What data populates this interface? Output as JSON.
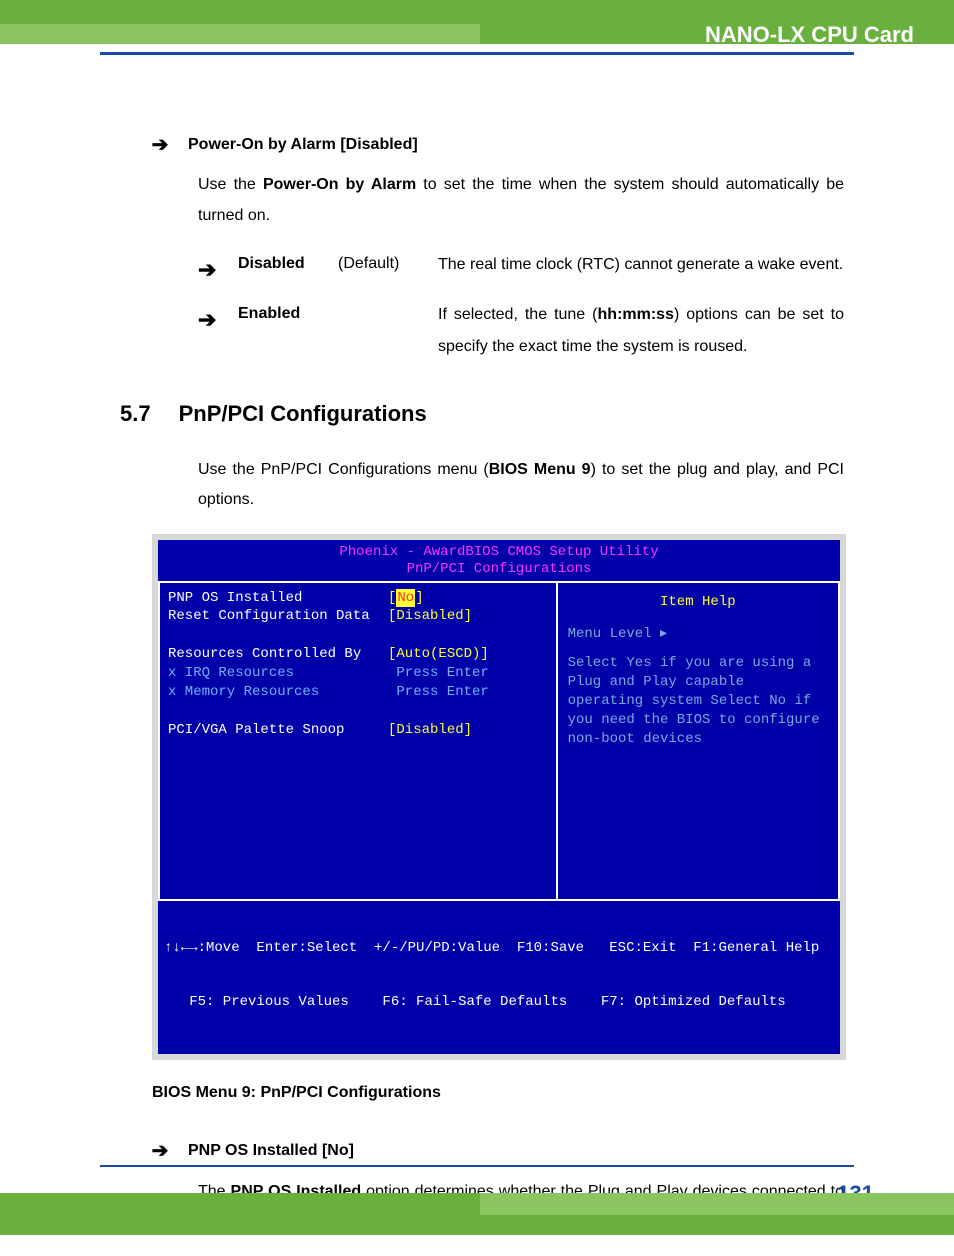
{
  "header": {
    "title": "NANO-LX CPU Card"
  },
  "footer": {
    "page": "131"
  },
  "item1": {
    "heading": "Power-On by Alarm [Disabled]",
    "body_pre": "Use the ",
    "body_bold": "Power-On by Alarm",
    "body_post": " to set the time when the system should automatically be turned on.",
    "options": [
      {
        "name": "Disabled",
        "def": "(Default)",
        "desc": "The real time clock (RTC) cannot generate a wake event."
      },
      {
        "name": "Enabled",
        "def": "",
        "desc_pre": "If selected, the tune (",
        "desc_bold": "hh:mm:ss",
        "desc_post": ") options can be set to specify the exact time the system is roused."
      }
    ]
  },
  "section": {
    "num": "5.7",
    "title": "PnP/PCI Configurations",
    "body_pre": "Use the PnP/PCI Configurations menu (",
    "body_bold": "BIOS Menu 9",
    "body_post": ") to set the plug and play, and PCI options."
  },
  "bios": {
    "title1": "Phoenix - AwardBIOS CMOS Setup Utility",
    "title2": "PnP/PCI Configurations",
    "lines": [
      {
        "label": "PNP OS Installed",
        "bracket_l": "[",
        "val": "No",
        "bracket_r": "]",
        "hilite": true
      },
      {
        "label": "Reset Configuration Data",
        "bracket_l": "[",
        "val": "Disabled",
        "bracket_r": "]"
      },
      {
        "label": ""
      },
      {
        "label": "Resources Controlled By",
        "bracket_l": "[",
        "val": "Auto(ESCD)",
        "bracket_r": "]"
      },
      {
        "label": "x IRQ Resources",
        "plain": " Press Enter",
        "dim": true
      },
      {
        "label": "x Memory Resources",
        "plain": " Press Enter",
        "dim": true
      },
      {
        "label": ""
      },
      {
        "label": "PCI/VGA Palette Snoop",
        "bracket_l": "[",
        "val": "Disabled",
        "bracket_r": "]"
      }
    ],
    "right_header": "Item Help",
    "right_body1": "Menu Level   ▸",
    "right_body2": "Select Yes if you are using a Plug and Play capable operating system Select No if you need the BIOS to configure non-boot devices",
    "foot1": "↑↓←→:Move  Enter:Select  +/-/PU/PD:Value  F10:Save   ESC:Exit  F1:General Help",
    "foot2": "   F5: Previous Values    F6: Fail-Safe Defaults    F7: Optimized Defaults"
  },
  "caption": "BIOS Menu 9: PnP/PCI Configurations",
  "item2": {
    "heading": "PNP OS Installed [No]",
    "body_pre": "The ",
    "body_bold": "PNP OS Installed",
    "body_post": " option determines whether the Plug and Play devices connected to the system are configured by the operating system or the BIOS."
  }
}
